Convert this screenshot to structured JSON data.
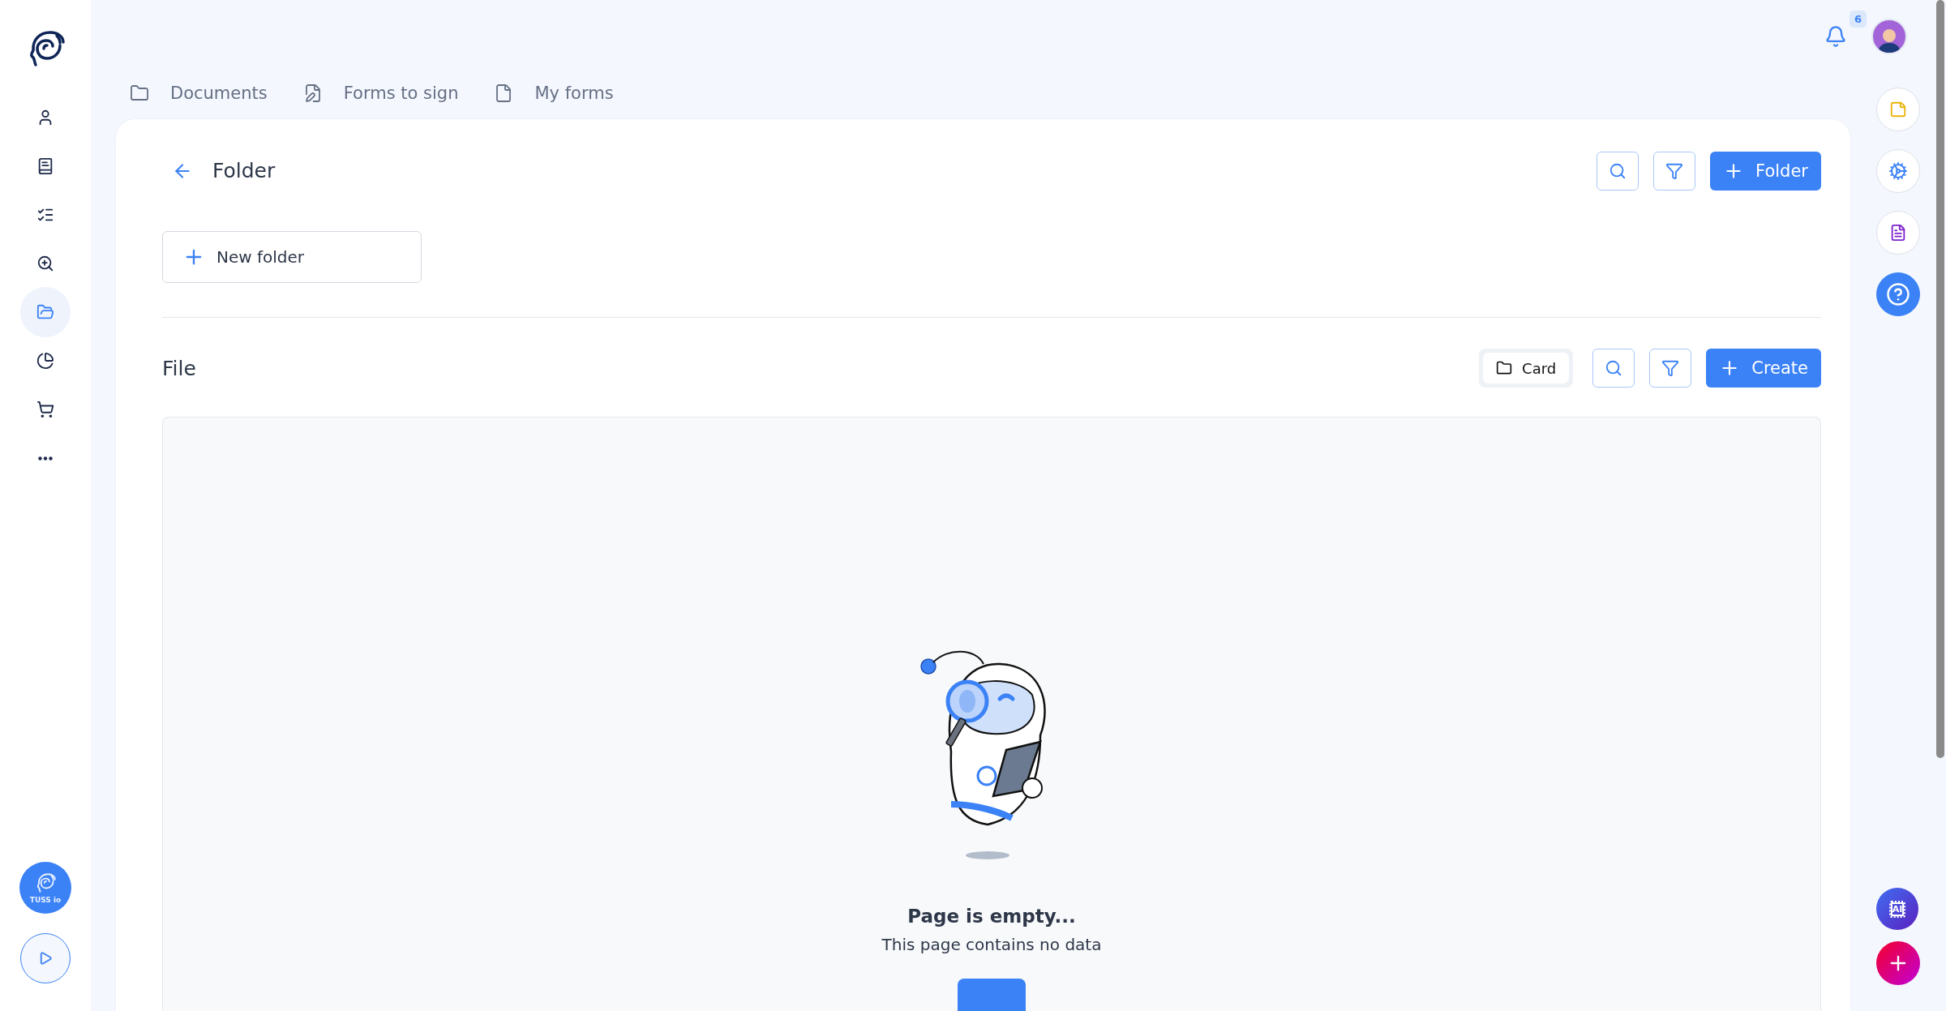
{
  "sidebar": {
    "nav": [
      {
        "selected": false
      },
      {
        "selected": false
      },
      {
        "selected": false
      },
      {
        "selected": false
      },
      {
        "selected": true
      },
      {
        "selected": false
      },
      {
        "selected": false
      },
      {
        "selected": false
      }
    ],
    "brand_badge": "TUSS io"
  },
  "header": {
    "notifications_count": "6"
  },
  "tabs": [
    {
      "label": "Documents"
    },
    {
      "label": "Forms to sign"
    },
    {
      "label": "My forms"
    }
  ],
  "folder_section": {
    "title": "Folder",
    "add_button": "Folder",
    "new_folder": "New folder"
  },
  "file_section": {
    "title": "File",
    "view_toggle": "Card",
    "create_button": "Create",
    "empty_state": {
      "title": "Page is empty...",
      "message": "This page contains no data"
    }
  },
  "ai_button": "AI"
}
